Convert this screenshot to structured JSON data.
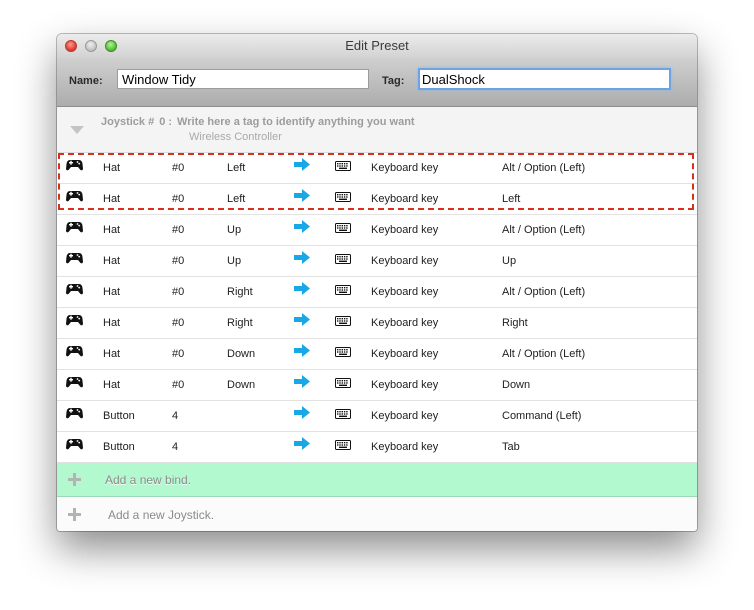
{
  "window": {
    "title": "Edit Preset"
  },
  "toolbar": {
    "name_label": "Name:",
    "name_value": "Window Tidy",
    "tag_label": "Tag:",
    "tag_value": "DualShock"
  },
  "joystick": {
    "label": "Joystick #",
    "index": "0 :",
    "tag_hint": "Write here a tag to identify anything you want",
    "device": "Wireless Controller"
  },
  "icons": {
    "gamepad": "gamepad-icon",
    "arrow": "right-arrow-icon",
    "keyboard": "keyboard-icon",
    "arrow_color": "#1aa7e6"
  },
  "binds": [
    {
      "type": "Hat",
      "number": "#0",
      "direction": "Left",
      "action": "Keyboard key",
      "key": "Alt / Option (Left)"
    },
    {
      "type": "Hat",
      "number": "#0",
      "direction": "Left",
      "action": "Keyboard key",
      "key": "Left"
    },
    {
      "type": "Hat",
      "number": "#0",
      "direction": "Up",
      "action": "Keyboard key",
      "key": "Alt / Option (Left)"
    },
    {
      "type": "Hat",
      "number": "#0",
      "direction": "Up",
      "action": "Keyboard key",
      "key": "Up"
    },
    {
      "type": "Hat",
      "number": "#0",
      "direction": "Right",
      "action": "Keyboard key",
      "key": "Alt / Option (Left)"
    },
    {
      "type": "Hat",
      "number": "#0",
      "direction": "Right",
      "action": "Keyboard key",
      "key": "Right"
    },
    {
      "type": "Hat",
      "number": "#0",
      "direction": "Down",
      "action": "Keyboard key",
      "key": "Alt / Option (Left)"
    },
    {
      "type": "Hat",
      "number": "#0",
      "direction": "Down",
      "action": "Keyboard key",
      "key": "Down"
    },
    {
      "type": "Button",
      "number": "4",
      "direction": "",
      "action": "Keyboard key",
      "key": "Command (Left)"
    },
    {
      "type": "Button",
      "number": "4",
      "direction": "",
      "action": "Keyboard key",
      "key": "Tab"
    }
  ],
  "add_bind_label": "Add a new bind.",
  "add_joystick_label": "Add a new Joystick."
}
